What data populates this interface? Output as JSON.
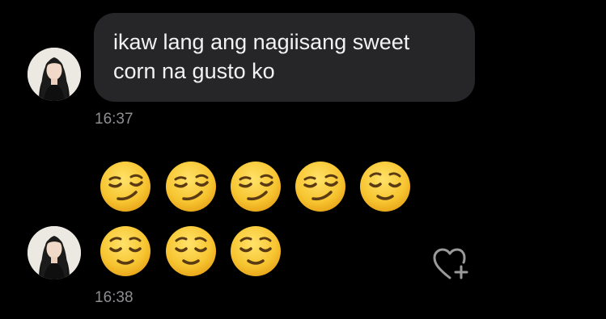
{
  "messages": [
    {
      "text": "ikaw lang ang nagiisang sweet corn na gusto ko",
      "time": "16:37"
    },
    {
      "emojis": [
        "smirking-face",
        "smirking-face",
        "smirking-face",
        "smirking-face",
        "relieved-face",
        "relieved-face",
        "relieved-face",
        "relieved-face"
      ],
      "time": "16:38"
    }
  ],
  "colors": {
    "background": "#000000",
    "bubble": "#262628",
    "message_text": "#f2f2f2",
    "timestamp": "#8e8e93",
    "emoji_face": "#f7c531",
    "icon": "#9a9a9a"
  },
  "icons": {
    "avatar": "profile-photo",
    "like": "heart-plus-icon"
  }
}
